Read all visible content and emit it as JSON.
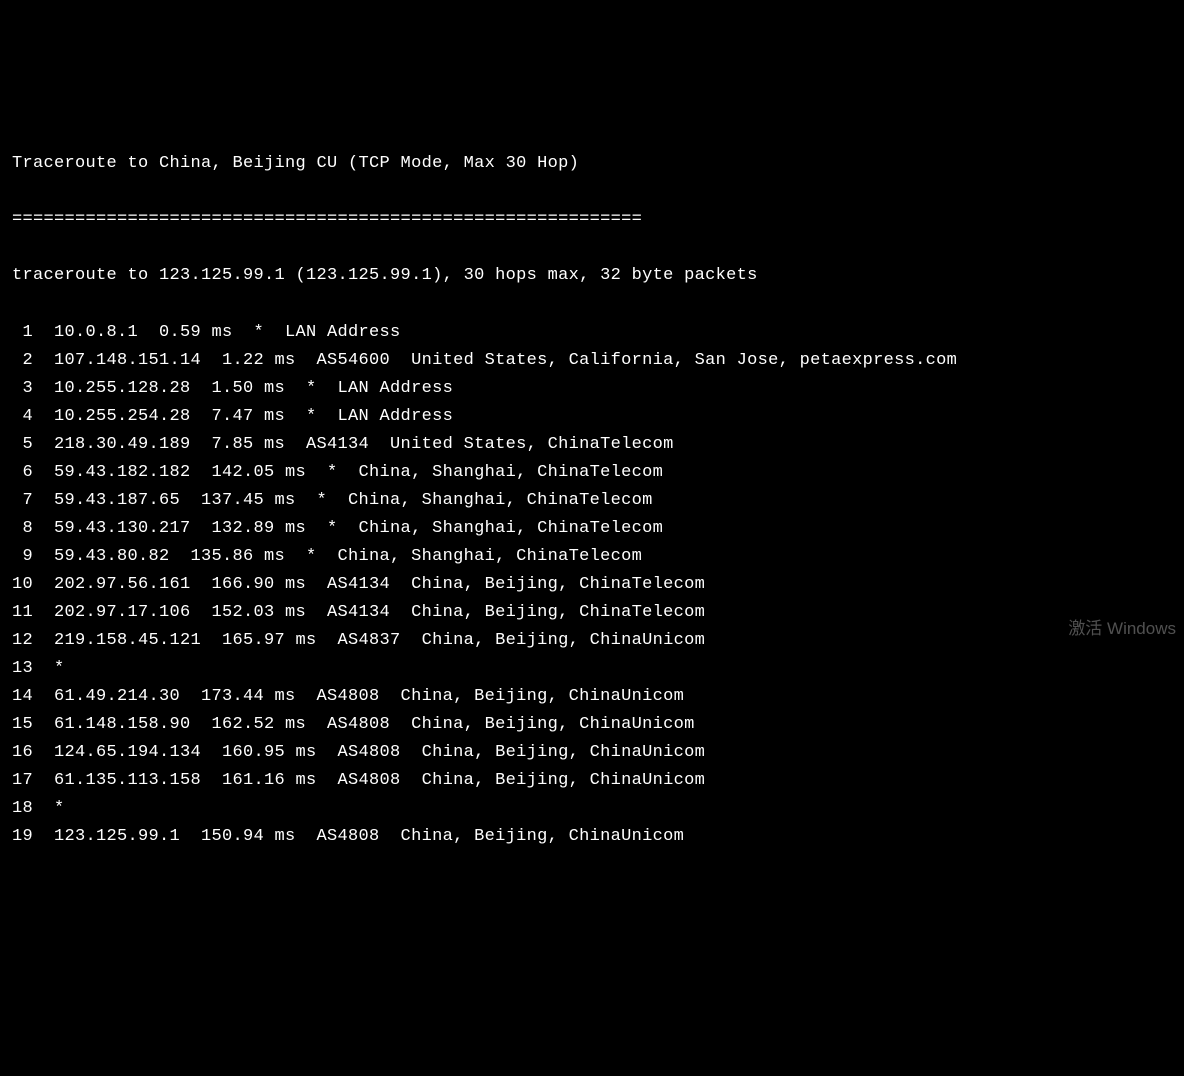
{
  "header": {
    "title": "Traceroute to China, Beijing CU (TCP Mode, Max 30 Hop)",
    "separator": "============================================================",
    "command": "traceroute to 123.125.99.1 (123.125.99.1), 30 hops max, 32 byte packets"
  },
  "hops": [
    {
      "num": " 1",
      "ip": "10.0.8.1",
      "latency": "0.59 ms",
      "asn": "*",
      "location": "LAN Address"
    },
    {
      "num": " 2",
      "ip": "107.148.151.14",
      "latency": "1.22 ms",
      "asn": "AS54600",
      "location": "United States, California, San Jose, petaexpress.com"
    },
    {
      "num": " 3",
      "ip": "10.255.128.28",
      "latency": "1.50 ms",
      "asn": "*",
      "location": "LAN Address"
    },
    {
      "num": " 4",
      "ip": "10.255.254.28",
      "latency": "7.47 ms",
      "asn": "*",
      "location": "LAN Address"
    },
    {
      "num": " 5",
      "ip": "218.30.49.189",
      "latency": "7.85 ms",
      "asn": "AS4134",
      "location": "United States, ChinaTelecom"
    },
    {
      "num": " 6",
      "ip": "59.43.182.182",
      "latency": "142.05 ms",
      "asn": "*",
      "location": "China, Shanghai, ChinaTelecom"
    },
    {
      "num": " 7",
      "ip": "59.43.187.65",
      "latency": "137.45 ms",
      "asn": "*",
      "location": "China, Shanghai, ChinaTelecom"
    },
    {
      "num": " 8",
      "ip": "59.43.130.217",
      "latency": "132.89 ms",
      "asn": "*",
      "location": "China, Shanghai, ChinaTelecom"
    },
    {
      "num": " 9",
      "ip": "59.43.80.82",
      "latency": "135.86 ms",
      "asn": "*",
      "location": "China, Shanghai, ChinaTelecom"
    },
    {
      "num": "10",
      "ip": "202.97.56.161",
      "latency": "166.90 ms",
      "asn": "AS4134",
      "location": "China, Beijing, ChinaTelecom"
    },
    {
      "num": "11",
      "ip": "202.97.17.106",
      "latency": "152.03 ms",
      "asn": "AS4134",
      "location": "China, Beijing, ChinaTelecom"
    },
    {
      "num": "12",
      "ip": "219.158.45.121",
      "latency": "165.97 ms",
      "asn": "AS4837",
      "location": "China, Beijing, ChinaUnicom"
    },
    {
      "num": "13",
      "timeout": "*"
    },
    {
      "num": "14",
      "ip": "61.49.214.30",
      "latency": "173.44 ms",
      "asn": "AS4808",
      "location": "China, Beijing, ChinaUnicom"
    },
    {
      "num": "15",
      "ip": "61.148.158.90",
      "latency": "162.52 ms",
      "asn": "AS4808",
      "location": "China, Beijing, ChinaUnicom"
    },
    {
      "num": "16",
      "ip": "124.65.194.134",
      "latency": "160.95 ms",
      "asn": "AS4808",
      "location": "China, Beijing, ChinaUnicom"
    },
    {
      "num": "17",
      "ip": "61.135.113.158",
      "latency": "161.16 ms",
      "asn": "AS4808",
      "location": "China, Beijing, ChinaUnicom"
    },
    {
      "num": "18",
      "timeout": "*"
    },
    {
      "num": "19",
      "ip": "123.125.99.1",
      "latency": "150.94 ms",
      "asn": "AS4808",
      "location": "China, Beijing, ChinaUnicom"
    }
  ],
  "activate": "激活 Windows"
}
